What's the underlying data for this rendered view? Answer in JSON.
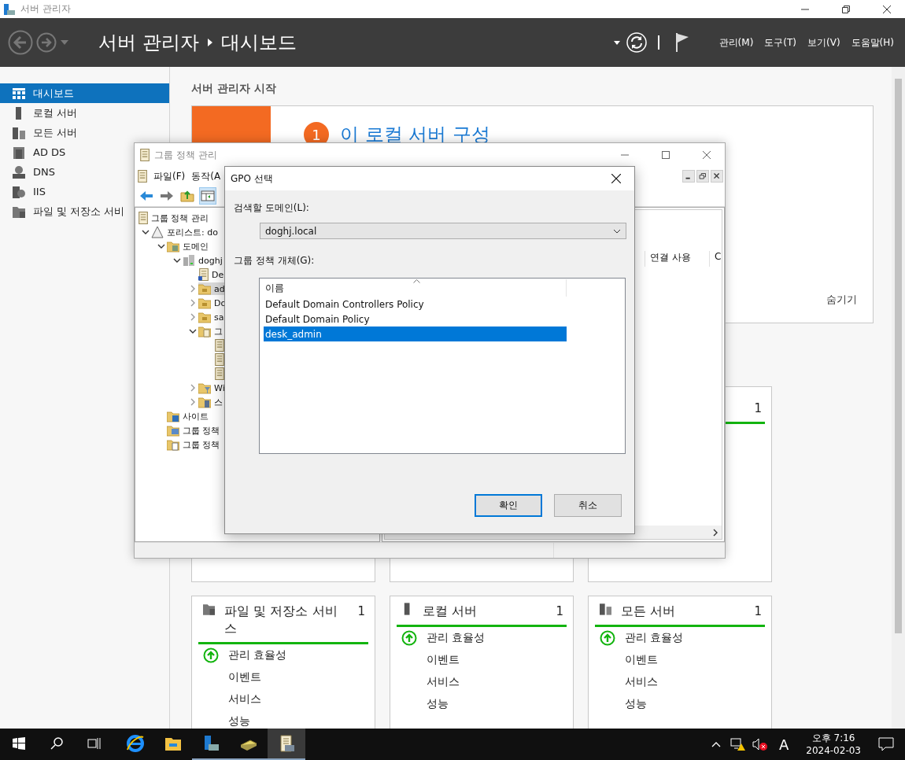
{
  "window": {
    "title": "서버 관리자"
  },
  "header": {
    "breadcrumb": [
      "서버 관리자",
      "대시보드"
    ],
    "menu": [
      "관리(M)",
      "도구(T)",
      "보기(V)",
      "도움말(H)"
    ]
  },
  "sidebar": {
    "items": [
      {
        "label": "대시보드",
        "kind": "dashboard",
        "selected": true
      },
      {
        "label": "로컬 서버",
        "kind": "server",
        "selected": false
      },
      {
        "label": "모든 서버",
        "kind": "servers",
        "selected": false
      },
      {
        "label": "AD DS",
        "kind": "adds",
        "selected": false
      },
      {
        "label": "DNS",
        "kind": "dns",
        "selected": false
      },
      {
        "label": "IIS",
        "kind": "iis",
        "selected": false
      },
      {
        "label": "파일 및 저장소 서비",
        "kind": "files",
        "selected": false
      }
    ]
  },
  "main": {
    "heading": "서버 관리자 시작",
    "welcome": {
      "step": "1",
      "text": "이 로컬 서버 구성",
      "hide": "숨기기"
    },
    "top_tiles": [
      {
        "kind": "blank"
      },
      {
        "kind": "blank"
      },
      {
        "kind": "count",
        "count": "1"
      }
    ],
    "tiles": [
      {
        "title": "파일 및 저장소 서비스",
        "count": "1",
        "kind": "files",
        "rows": [
          {
            "label": "관리 효율성",
            "healthy": true
          },
          {
            "label": "이벤트"
          },
          {
            "label": "서비스"
          },
          {
            "label": "성능"
          }
        ]
      },
      {
        "title": "로컬 서버",
        "count": "1",
        "kind": "server",
        "rows": [
          {
            "label": "관리 효율성",
            "healthy": true
          },
          {
            "label": "이벤트"
          },
          {
            "label": "서비스"
          },
          {
            "label": "성능"
          }
        ]
      },
      {
        "title": "모든 서버",
        "count": "1",
        "kind": "servers",
        "rows": [
          {
            "label": "관리 효율성",
            "healthy": true
          },
          {
            "label": "이벤트"
          },
          {
            "label": "서비스"
          },
          {
            "label": "성능"
          }
        ]
      }
    ]
  },
  "gpm_window": {
    "title": "그룹 정책 관리",
    "menu": [
      "파일(F)",
      "동작(A"
    ],
    "tree": [
      {
        "label": "그룹 정책 관리",
        "kind": "scroll",
        "selected": false,
        "children": [
          {
            "label": "포리스트: do",
            "kind": "forest",
            "selected": false,
            "expanded": true,
            "children": [
              {
                "label": "도메인",
                "kind": "domains",
                "selected": false,
                "expanded": true,
                "children": [
                  {
                    "label": "doghj",
                    "kind": "domain",
                    "selected": false,
                    "expanded": true,
                    "children": [
                      {
                        "label": "De",
                        "kind": "link",
                        "selected": false
                      },
                      {
                        "label": "ad",
                        "kind": "ou",
                        "selected": true,
                        "expanded": false
                      },
                      {
                        "label": "Do",
                        "kind": "ou",
                        "selected": false,
                        "expanded": false
                      },
                      {
                        "label": "sa",
                        "kind": "ou",
                        "selected": false,
                        "expanded": false
                      },
                      {
                        "label": "그",
                        "kind": "gpo-folder",
                        "selected": false,
                        "expanded": true,
                        "children": [
                          {
                            "kind": "gpo",
                            "selected": false
                          },
                          {
                            "kind": "gpo",
                            "selected": false
                          },
                          {
                            "kind": "gpo",
                            "selected": false
                          }
                        ]
                      },
                      {
                        "label": "Wi",
                        "kind": "wmi",
                        "selected": false,
                        "expanded": false
                      },
                      {
                        "label": "스",
                        "kind": "starter",
                        "selected": false,
                        "expanded": false
                      }
                    ]
                  }
                ]
              },
              {
                "label": "사이트",
                "kind": "sites",
                "selected": false
              },
              {
                "label": "그룹 정책",
                "kind": "modeling",
                "selected": false
              },
              {
                "label": "그룹 정책",
                "kind": "results",
                "selected": false
              }
            ]
          }
        ]
      }
    ],
    "columns": [
      "연결 사용",
      "C"
    ]
  },
  "dialog": {
    "title": "GPO 선택",
    "domain_label": "검색할 도메인(L):",
    "domain": "doghj.local",
    "list_label": "그룹 정책 개체(G):",
    "column": "이름",
    "items": [
      {
        "label": "Default Domain Controllers Policy",
        "selected": false
      },
      {
        "label": "Default Domain Policy",
        "selected": false
      },
      {
        "label": "desk_admin",
        "selected": true
      }
    ],
    "buttons": [
      {
        "label": "확인",
        "default": true
      },
      {
        "label": "취소",
        "default": false
      }
    ]
  },
  "taskbar": {
    "apps": [
      {
        "kind": "ie",
        "running": false,
        "active": false
      },
      {
        "kind": "explorer",
        "running": false,
        "active": false
      },
      {
        "kind": "servermgr",
        "running": true,
        "active": false
      },
      {
        "kind": "book",
        "running": true,
        "active": false
      },
      {
        "kind": "gpm",
        "running": true,
        "active": true
      }
    ],
    "ime": "A",
    "time": "오후 7:16",
    "date": "2024-02-03"
  }
}
